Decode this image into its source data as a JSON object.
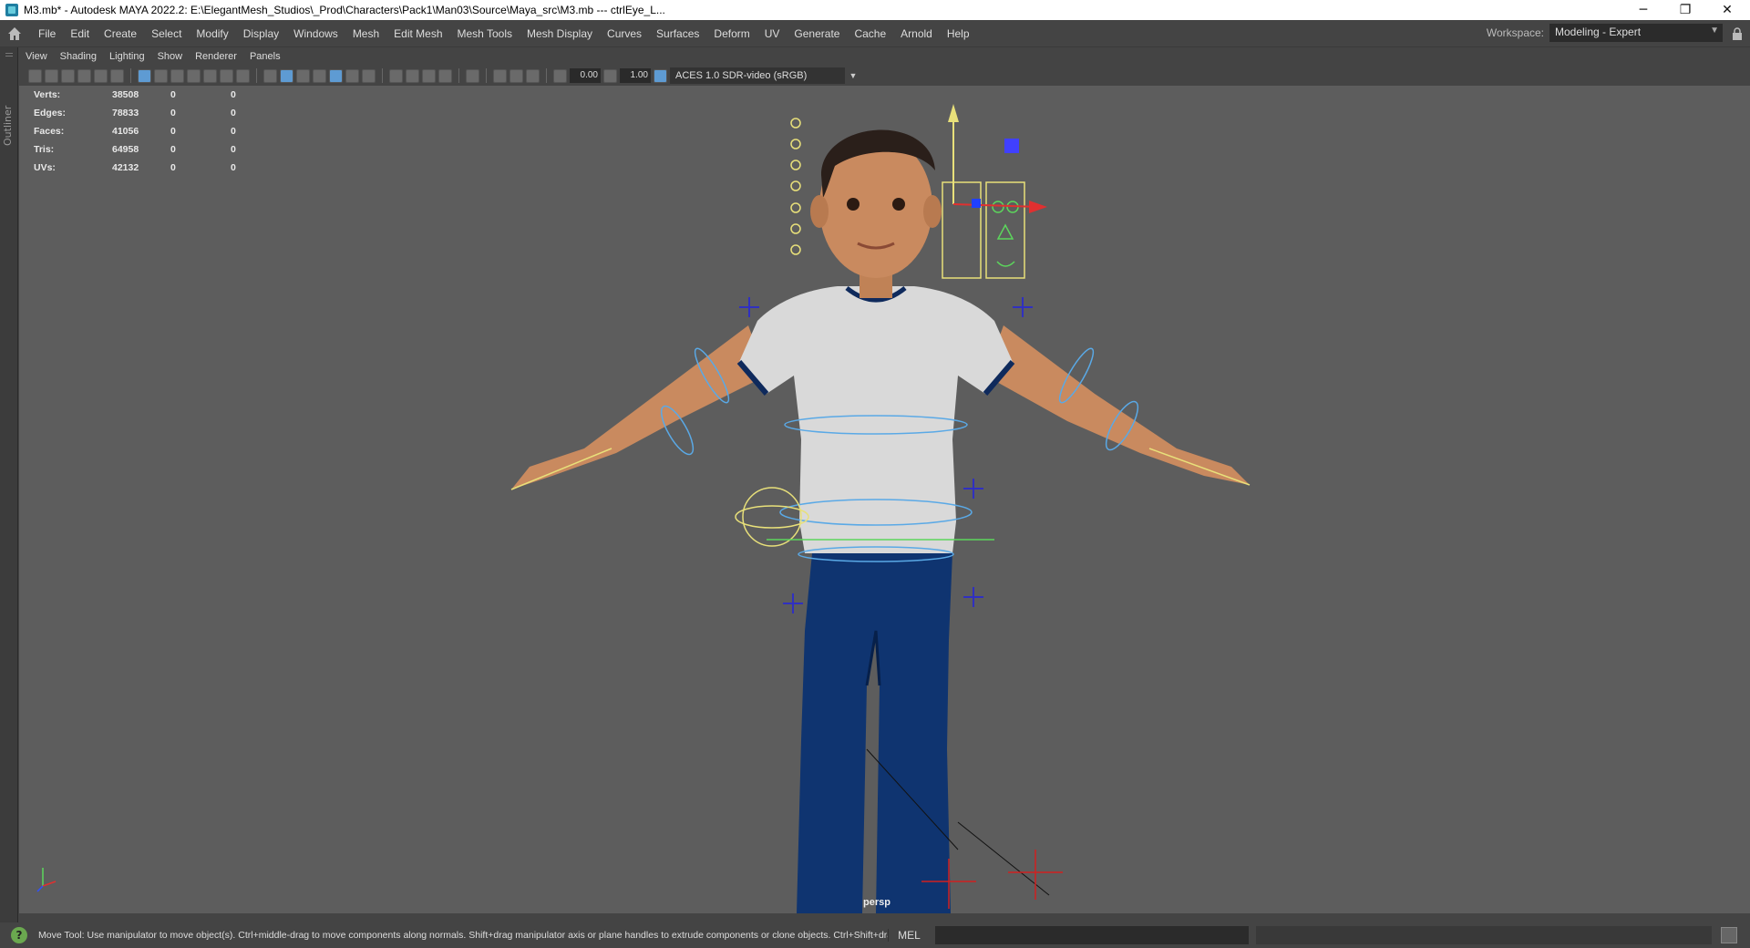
{
  "window": {
    "title": "M3.mb* - Autodesk MAYA 2022.2: E:\\ElegantMesh_Studios\\_Prod\\Characters\\Pack1\\Man03\\Source\\Maya_src\\M3.mb  ---  ctrlEye_L...",
    "minimize": "─",
    "restore": "❐",
    "close": "✕"
  },
  "menubar": {
    "items": [
      "File",
      "Edit",
      "Create",
      "Select",
      "Modify",
      "Display",
      "Windows",
      "Mesh",
      "Edit Mesh",
      "Mesh Tools",
      "Mesh Display",
      "Curves",
      "Surfaces",
      "Deform",
      "UV",
      "Generate",
      "Cache",
      "Arnold",
      "Help"
    ],
    "workspace_label": "Workspace:",
    "workspace_value": "Modeling - Expert"
  },
  "outliner": {
    "label": "Outliner"
  },
  "panel": {
    "menu": [
      "View",
      "Shading",
      "Lighting",
      "Show",
      "Renderer",
      "Panels"
    ],
    "exposure": "0.00",
    "gamma": "1.00",
    "color_space": "ACES 1.0 SDR-video (sRGB)"
  },
  "hud": {
    "rows": [
      {
        "label": "Verts:",
        "total": "38508",
        "sel": "0",
        "comp": "0"
      },
      {
        "label": "Edges:",
        "total": "78833",
        "sel": "0",
        "comp": "0"
      },
      {
        "label": "Faces:",
        "total": "41056",
        "sel": "0",
        "comp": "0"
      },
      {
        "label": "Tris:",
        "total": "64958",
        "sel": "0",
        "comp": "0"
      },
      {
        "label": "UVs:",
        "total": "42132",
        "sel": "0",
        "comp": "0"
      }
    ]
  },
  "viewport": {
    "camera_label": "persp"
  },
  "helpline": {
    "message": "Move Tool: Use manipulator to move object(s). Ctrl+middle-drag to move components along normals. Shift+drag manipulator axis or plane handles to extrude components or clone objects. Ctrl+Shift+drag to con",
    "language": "MEL"
  },
  "colors": {
    "viewport_bg": "#5d5d5d",
    "shirt": "#d9d9d9",
    "pants": "#0f3470",
    "skin": "#c98a5f",
    "ctrl_blue": "#5aa9e6",
    "ctrl_yellow": "#e8e07a"
  }
}
